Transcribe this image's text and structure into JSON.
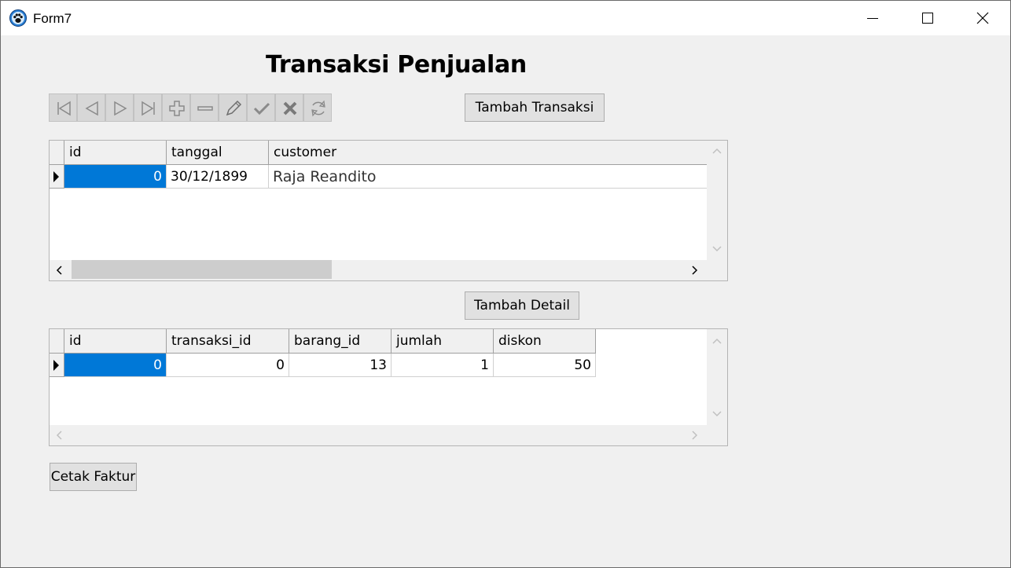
{
  "window": {
    "title": "Form7",
    "icons": {
      "app": "paw-icon",
      "minimize": "minimize-icon",
      "maximize": "maximize-icon",
      "close": "close-icon"
    }
  },
  "page": {
    "title": "Transaksi Penjualan"
  },
  "navigator": {
    "buttons": [
      "first-icon",
      "prior-icon",
      "next-icon",
      "last-icon",
      "insert-icon",
      "delete-icon",
      "edit-icon",
      "post-icon",
      "cancel-icon",
      "refresh-icon"
    ]
  },
  "buttons": {
    "tambah_transaksi": "Tambah Transaksi",
    "tambah_detail": "Tambah Detail",
    "cetak_faktur": "Cetak Faktur"
  },
  "transaksi_grid": {
    "columns": [
      "id",
      "tanggal",
      "customer"
    ],
    "rows": [
      {
        "id": "0",
        "tanggal": "30/12/1899",
        "customer": "Raja Reandito"
      }
    ]
  },
  "detail_grid": {
    "columns": [
      "id",
      "transaksi_id",
      "barang_id",
      "jumlah",
      "diskon"
    ],
    "rows": [
      {
        "id": "0",
        "transaksi_id": "0",
        "barang_id": "13",
        "jumlah": "1",
        "diskon": "50"
      }
    ]
  },
  "colors": {
    "selection": "#0078d7",
    "background": "#f0f0f0"
  }
}
